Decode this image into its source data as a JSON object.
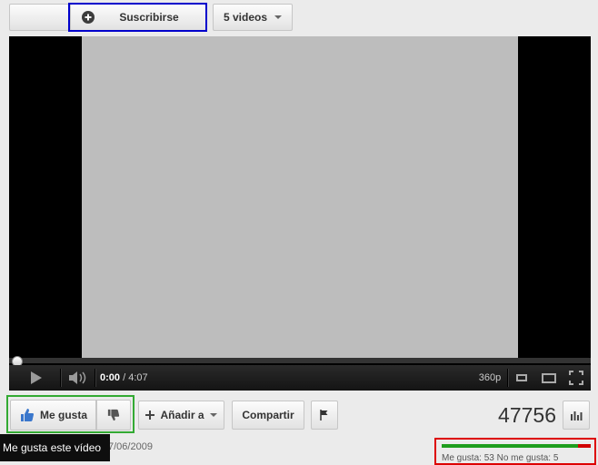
{
  "channel": {
    "subscribe_label": "Suscribirse",
    "videos_label": "5 videos"
  },
  "player": {
    "time_current": "0:00",
    "time_separator": " / ",
    "time_total": "4:07",
    "quality": "360p",
    "progress_fraction": 0
  },
  "actions": {
    "like_label": "Me gusta",
    "add_to_label": "Añadir a",
    "share_label": "Compartir"
  },
  "stats": {
    "view_count": "47756",
    "likes_text": "Me gusta: 53 No me gusta: 5",
    "like_ratio": 0.914
  },
  "tooltip": "Me gusta este vídeo",
  "upload_date_partial": "7/06/2009",
  "colors": {
    "subscribe_highlight": "#0000cc",
    "like_highlight": "#33aa33",
    "ratings_highlight": "#dd0000",
    "like_bar": "#1e9e1e",
    "dislike_bar": "#d10000",
    "like_icon": "#3a77cc"
  }
}
